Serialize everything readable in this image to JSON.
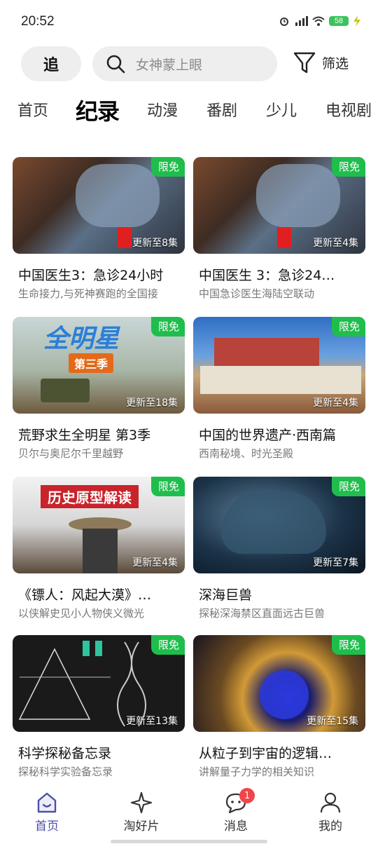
{
  "status": {
    "time": "20:52",
    "battery": "58"
  },
  "topbar": {
    "follow_label": "追",
    "search_placeholder": "女神蒙上眼",
    "filter_label": "筛选"
  },
  "categories": [
    {
      "label": "首页"
    },
    {
      "label": "纪录"
    },
    {
      "label": "动漫"
    },
    {
      "label": "番剧"
    },
    {
      "label": "少儿"
    },
    {
      "label": "电视剧"
    }
  ],
  "active_category": "纪录",
  "cards": [
    {
      "badge": "限免",
      "episodes": "更新至8集",
      "title": "中国医生3：急诊24小时",
      "subtitle": "生命接力,与死神赛跑的全国接"
    },
    {
      "badge": "限免",
      "episodes": "更新至4集",
      "title": "中国医生 3：急诊24…",
      "subtitle": "中国急诊医生海陆空联动"
    },
    {
      "badge": "限免",
      "episodes": "更新至18集",
      "title": "荒野求生全明星 第3季",
      "subtitle": "贝尔与奥尼尔千里越野",
      "overlay1": "全明星",
      "overlay2": "第三季"
    },
    {
      "badge": "限免",
      "episodes": "更新至4集",
      "title": "中国的世界遗产·西南篇",
      "subtitle": "西南秘境、时光圣殿"
    },
    {
      "badge": "限免",
      "episodes": "更新至4集",
      "title": "《镖人：风起大漠》…",
      "subtitle": "以侠解史见小人物侠义微光",
      "overlay1": "历史原型解读"
    },
    {
      "badge": "限免",
      "episodes": "更新至7集",
      "title": "深海巨兽",
      "subtitle": "探秘深海禁区直面远古巨兽"
    },
    {
      "badge": "限免",
      "episodes": "更新至13集",
      "title": "科学探秘备忘录",
      "subtitle": "探秘科学实验备忘录"
    },
    {
      "badge": "限免",
      "episodes": "更新至15集",
      "title": "从粒子到宇宙的逻辑…",
      "subtitle": "讲解量子力学的相关知识"
    }
  ],
  "bottom_nav": [
    {
      "label": "首页",
      "icon": "home-icon"
    },
    {
      "label": "淘好片",
      "icon": "sparkle-icon"
    },
    {
      "label": "消息",
      "icon": "message-icon",
      "badge": "1"
    },
    {
      "label": "我的",
      "icon": "profile-icon"
    }
  ]
}
